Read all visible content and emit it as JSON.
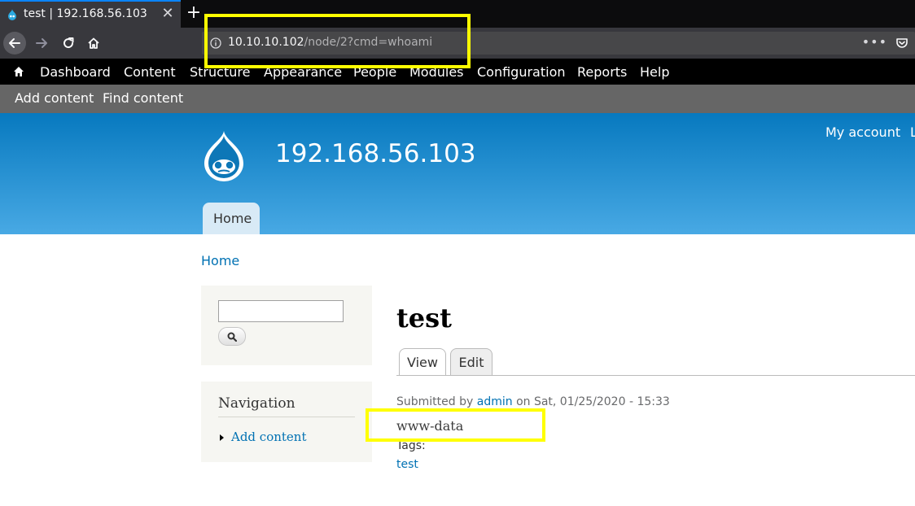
{
  "browser": {
    "tab_title": "test | 192.168.56.103",
    "tab_close": "✕",
    "new_tab": "+",
    "url_host": "10.10.10.102",
    "url_path": "/node/2?cmd=whoami",
    "menu_dots": "•••"
  },
  "admin_toolbar": {
    "items": [
      "Dashboard",
      "Content",
      "Structure",
      "Appearance",
      "People",
      "Modules",
      "Configuration",
      "Reports",
      "Help"
    ]
  },
  "shortcuts": {
    "items": [
      "Add content",
      "Find content"
    ]
  },
  "header": {
    "site_name": "192.168.56.103",
    "secondary_menu": [
      "My account",
      "L"
    ],
    "main_menu": [
      "Home"
    ]
  },
  "breadcrumb": "Home",
  "sidebar": {
    "search_value": "",
    "navigation_title": "Navigation",
    "navigation_items": [
      "Add content"
    ]
  },
  "node": {
    "title": "test",
    "tabs": [
      "View",
      "Edit"
    ],
    "submitted_prefix": "Submitted by",
    "author": "admin",
    "submitted_suffix": "on Sat, 01/25/2020 - 15:33",
    "body": "www-data",
    "tags_label": "Tags:",
    "tags": [
      "test"
    ]
  },
  "colors": {
    "highlight": "#ffff00",
    "link": "#0071b3",
    "header_top": "#0779bf",
    "header_bottom": "#48a9e4",
    "admin_toolbar": "#000000",
    "shortcuts_bar": "#666666"
  }
}
